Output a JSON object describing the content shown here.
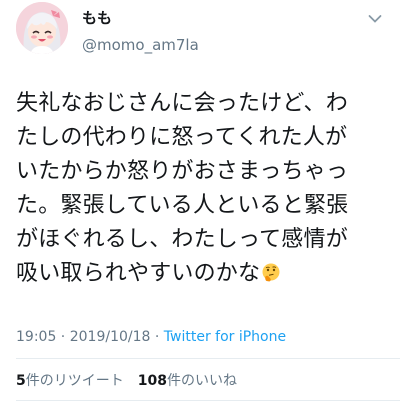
{
  "author": {
    "display_name": "もも",
    "handle": "@momo_am7la"
  },
  "tweet": {
    "text": "失礼なおじさんに会ったけど、わ\nたしの代わりに怒ってくれた人が\nいたからか怒りがおさまっちゃっ\nた。緊張している人といると緊張\nがほぐれるし、わたしって感情が\n吸い取られやすいのかな",
    "emoji": "thinking-face-emoji"
  },
  "meta": {
    "time": "19:05",
    "separator": " · ",
    "date": "2019/10/18",
    "source": "Twitter for iPhone"
  },
  "stats": {
    "retweets_count": "5",
    "retweets_label": "件のリツイート",
    "likes_count": "108",
    "likes_label": "件のいいね"
  },
  "colors": {
    "link": "#1da1f2",
    "secondary_text": "#657786",
    "divider": "#e6ecf0"
  },
  "icons": {
    "avatar": "anime-girl-avatar",
    "menu": "chevron-down-icon"
  }
}
